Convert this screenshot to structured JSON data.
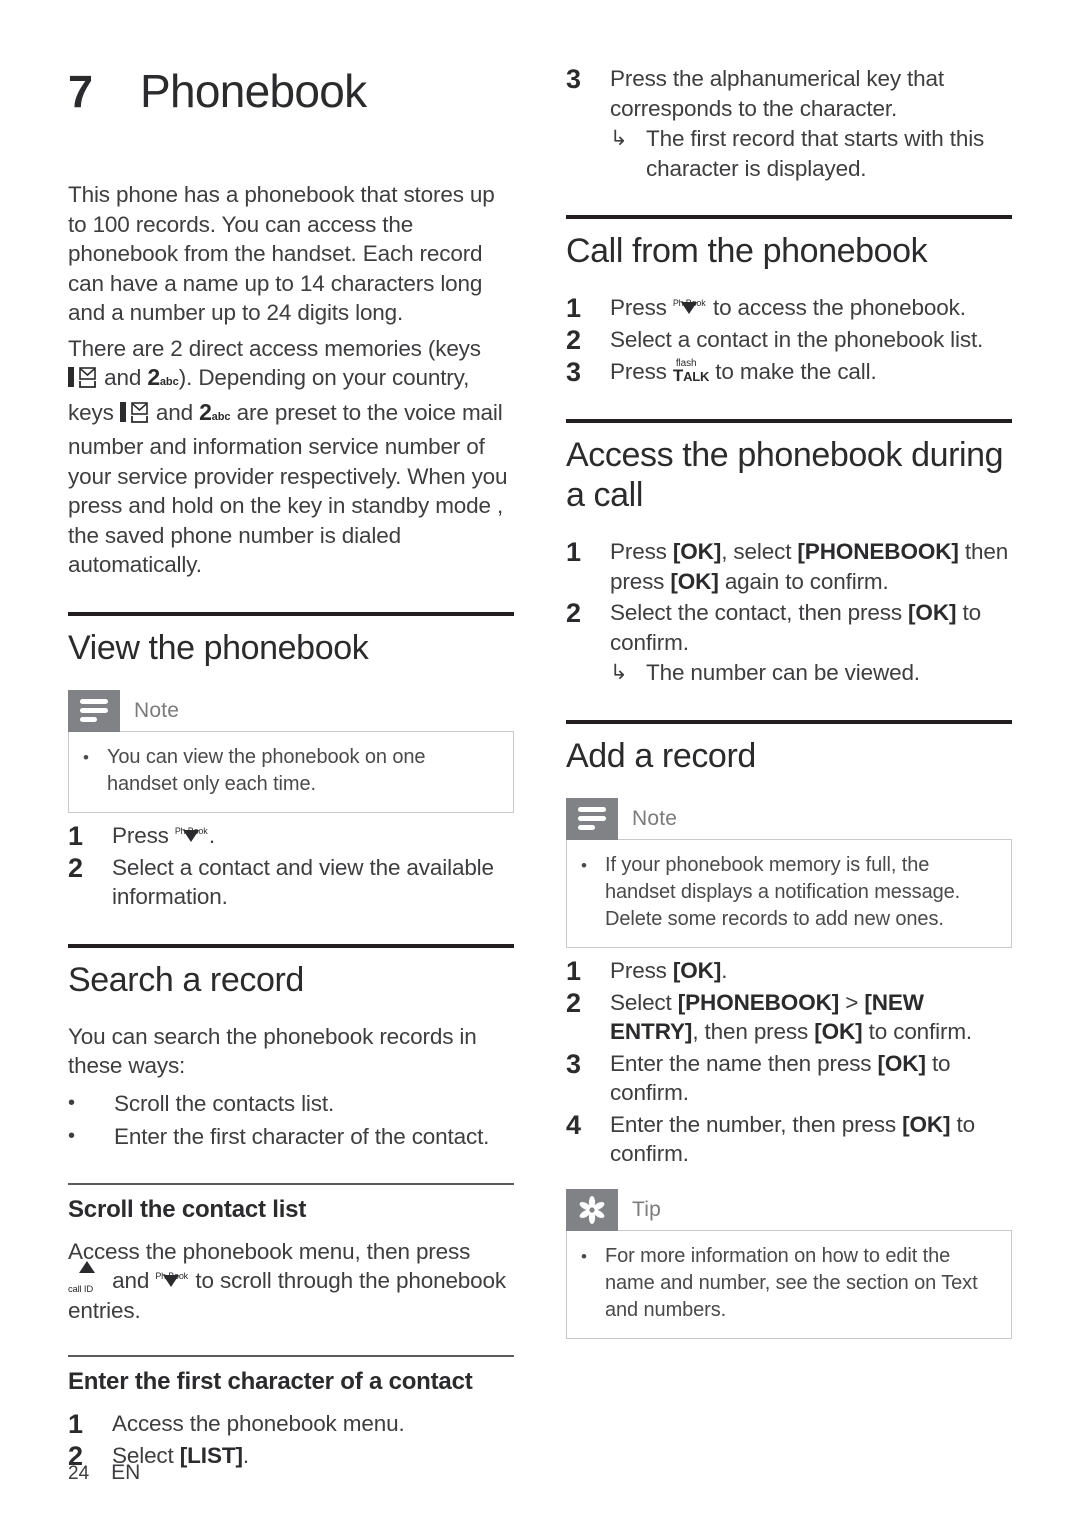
{
  "chapter": {
    "number": "7",
    "title": "Phonebook"
  },
  "intro": {
    "paragraph1": "This phone has a phonebook that stores up to 100 records. You can access the phonebook from the handset. Each record can have a name up to 14 characters long and a number up to 24 digits long.",
    "paragraph2_part1": "There are 2 direct access memories (keys",
    "paragraph2_part2": "and",
    "paragraph2_part3": "). Depending on your country, keys",
    "paragraph2_part4": "and",
    "paragraph2_part5": "are preset to the voice mail number and information service number of your service provider respectively. When you press and hold on the key in standby mode , the saved phone number is dialed automatically."
  },
  "keys": {
    "voicemail_digit": "1",
    "voicemail_icon": "envelope-icon",
    "key2_digit": "2",
    "key2_letters": "abc",
    "phbook_label": "Ph.Book",
    "phbook_icon": "down-triangle-icon",
    "callid_label": "call ID",
    "callid_icon": "up-triangle-icon",
    "talk_flash_label": "flash",
    "talk_label_t": "T",
    "talk_label_rest": "ALK"
  },
  "sections": {
    "view_phonebook": {
      "heading": "View the phonebook",
      "note": {
        "label": "Note",
        "icon": "note-lines-icon",
        "bullets": [
          "You can view the phonebook on one handset only each time."
        ]
      },
      "steps": [
        {
          "num": "1",
          "text_before": "Press",
          "text_after": "."
        },
        {
          "num": "2",
          "text": "Select a contact and view the available information."
        }
      ]
    },
    "search_record": {
      "heading": "Search a record",
      "intro": "You can search the phonebook records in these ways:",
      "bullets": [
        "Scroll the contacts list.",
        "Enter the first character of the contact."
      ],
      "scroll_contact_list": {
        "heading": "Scroll the contact list",
        "text_before": "Access the phonebook menu, then press",
        "text_middle": "and",
        "text_after": "to scroll through the phonebook entries."
      },
      "enter_first_character": {
        "heading": "Enter the first character of a contact",
        "steps": [
          {
            "num": "1",
            "text": "Access the phonebook menu."
          },
          {
            "num": "2",
            "text_before": "Select",
            "menu": "[LIST]",
            "text_after": "."
          }
        ]
      }
    },
    "step3_continued": {
      "num": "3",
      "text": "Press the alphanumerical key that corresponds to the character.",
      "result_arrow": "↳",
      "result": "The first record that starts with this character is displayed."
    },
    "call_from_phonebook": {
      "heading": "Call from the phonebook",
      "steps": [
        {
          "num": "1",
          "text_before": "Press",
          "text_after": "to access the phonebook."
        },
        {
          "num": "2",
          "text": "Select a contact in the phonebook list."
        },
        {
          "num": "3",
          "text_before": "Press",
          "text_after": "to make the call."
        }
      ]
    },
    "access_during_call": {
      "heading": "Access the phonebook during a call",
      "steps": [
        {
          "num": "1",
          "p1": "Press ",
          "m1": "[OK]",
          "p2": ", select ",
          "m2": "[PHONEBOOK]",
          "p3": " then press ",
          "m3": "[OK]",
          "p4": " again to confirm."
        },
        {
          "num": "2",
          "p1": "Select the contact, then press ",
          "m1": "[OK]",
          "p2": " to confirm.",
          "result_arrow": "↳",
          "result": "The number can be viewed."
        }
      ]
    },
    "add_record": {
      "heading": "Add a record",
      "note": {
        "label": "Note",
        "icon": "note-lines-icon",
        "bullets": [
          "If your phonebook memory is full, the handset displays a notification message. Delete some records to add new ones."
        ]
      },
      "steps": [
        {
          "num": "1",
          "p1": "Press ",
          "m1": "[OK]",
          "p2": "."
        },
        {
          "num": "2",
          "p1": "Select ",
          "m1": "[PHONEBOOK]",
          "p2": " > ",
          "m2": "[NEW ENTRY]",
          "p3": ", then press ",
          "m3": "[OK]",
          "p4": " to confirm."
        },
        {
          "num": "3",
          "p1": "Enter the name then press ",
          "m1": "[OK]",
          "p2": " to confirm."
        },
        {
          "num": "4",
          "p1": "Enter the number, then press ",
          "m1": "[OK]",
          "p2": " to confirm."
        }
      ],
      "tip": {
        "label": "Tip",
        "icon": "asterisk-flower-icon",
        "bullets": [
          "For more information on how to edit the name and number, see the section on Text and numbers."
        ]
      }
    }
  },
  "footer": {
    "page_number": "24",
    "language": "EN"
  },
  "colors": {
    "text": "#3e3e40",
    "heading": "#2b2b2d",
    "callout_tab": "#808286",
    "callout_border": "#c9c9cb",
    "rule_heavy": "#231f20"
  }
}
